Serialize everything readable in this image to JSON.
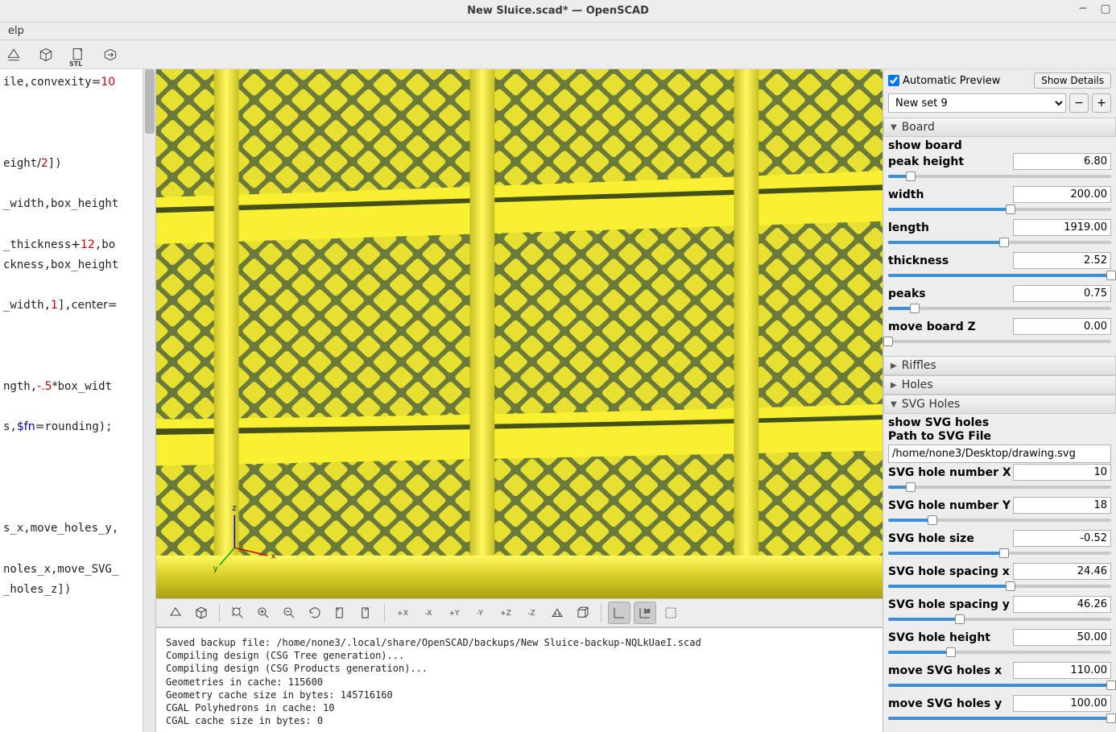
{
  "window": {
    "title": "New Sluice.scad* — OpenSCAD",
    "menu_help": "elp"
  },
  "customizer": {
    "auto_preview_label": "Automatic Preview",
    "auto_preview_checked": true,
    "show_details_label": "Show Details",
    "preset_selected": "New set 9",
    "preset_delete": "−",
    "preset_add": "+",
    "sections": {
      "board": {
        "title": "Board",
        "expanded": true,
        "show_board_label": "show board",
        "fields": [
          {
            "label": "peak height",
            "value": "6.80",
            "fill": 10
          },
          {
            "label": "width",
            "value": "200.00",
            "fill": 55
          },
          {
            "label": "length",
            "value": "1919.00",
            "fill": 52
          },
          {
            "label": "thickness",
            "value": "2.52",
            "fill": 100
          },
          {
            "label": "peaks",
            "value": "0.75",
            "fill": 12
          },
          {
            "label": "move board Z",
            "value": "0.00",
            "fill": 0
          }
        ]
      },
      "riffles": {
        "title": "Riffles",
        "expanded": false
      },
      "holes": {
        "title": "Holes",
        "expanded": false
      },
      "svg_holes": {
        "title": "SVG Holes",
        "expanded": true,
        "show_label": "show SVG holes",
        "path_label": "Path to SVG File",
        "path_value": "/home/none3/Desktop/drawing.svg",
        "fields": [
          {
            "label": "SVG hole number X",
            "value": "10",
            "fill": 10
          },
          {
            "label": "SVG hole number Y",
            "value": "18",
            "fill": 20
          },
          {
            "label": "SVG hole size",
            "value": "-0.52",
            "fill": 52
          },
          {
            "label": "SVG hole spacing x",
            "value": "24.46",
            "fill": 55
          },
          {
            "label": "SVG hole spacing y",
            "value": "46.26",
            "fill": 32
          },
          {
            "label": "SVG hole height",
            "value": "50.00",
            "fill": 28
          },
          {
            "label": "move SVG holes x",
            "value": "110.00",
            "fill": 100
          },
          {
            "label": "move SVG holes y",
            "value": "100.00",
            "fill": 100
          }
        ]
      }
    }
  },
  "code": {
    "lines": [
      "ile,convexity<span class=\"op\">=</span><span class=\"num\">10</span>",
      "",
      "",
      "",
      "eight<span class=\"op\">/</span><span class=\"num\">2</span>])",
      "",
      "_width,box_height",
      "",
      "_thickness<span class=\"op\">+</span><span class=\"num\">12</span>,bo",
      "ckness,box_height",
      "",
      "_width,<span class=\"num\">1</span>],<span class=\"fn\">center</span><span class=\"op\">=</span>",
      "",
      "",
      "",
      "ngth,<span class=\"num\">-.5</span><span class=\"op\">*</span>box_widt",
      "",
      "s,<span class=\"kw\">$fn</span><span class=\"op\">=</span>rounding);",
      "",
      "",
      "",
      "",
      "s_x,move_holes_y,",
      "",
      "noles_x,move_SVG_",
      "_holes_z])"
    ]
  },
  "console": {
    "lines": [
      "Saved backup file: /home/none3/.local/share/OpenSCAD/backups/New Sluice-backup-NQLkUaeI.scad",
      "Compiling design (CSG Tree generation)...",
      "Compiling design (CSG Products generation)...",
      "Geometries in cache: 115600",
      "Geometry cache size in bytes: 145716160",
      "CGAL Polyhedrons in cache: 10",
      "CGAL cache size in bytes: 0"
    ]
  }
}
